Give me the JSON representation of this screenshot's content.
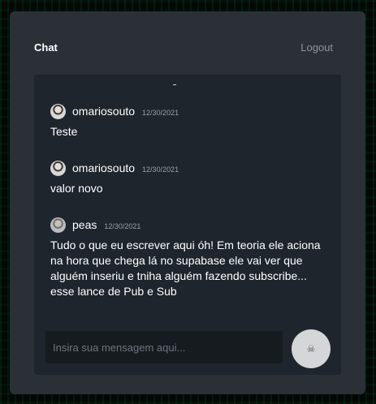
{
  "header": {
    "title": "Chat",
    "logout_label": "Logout"
  },
  "messages": [
    {
      "username": "omariosouto",
      "timestamp": "12/30/2021",
      "text": "Teste",
      "avatar_icon": "user-photo-icon"
    },
    {
      "username": "omariosouto",
      "timestamp": "12/30/2021",
      "text": "valor novo",
      "avatar_icon": "user-photo-icon"
    },
    {
      "username": "peas",
      "timestamp": "12/30/2021",
      "text": "Tudo o que eu escrever aqui óh! Em teoria ele aciona na hora que chega lá no supabase ele vai ver que alguém inseriu e tniha alguém fazendo subscribe... esse lance de Pub e Sub",
      "avatar_icon": "user-photo-icon"
    }
  ],
  "composer": {
    "placeholder": "Insira sua mensagem aqui...",
    "value": "",
    "send_icon": "skull-icon"
  },
  "colors": {
    "panel": "#2b3036",
    "chat_area": "#1f252c",
    "input": "#161b20",
    "send_button": "#d4d6d8",
    "background": "#040806"
  }
}
